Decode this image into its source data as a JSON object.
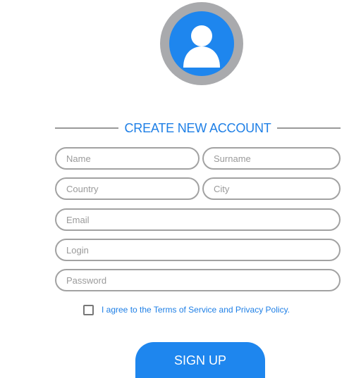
{
  "header": {
    "avatar_icon": "user-silhouette-icon",
    "title": "CREATE NEW ACCOUNT"
  },
  "form": {
    "name_placeholder": "Name",
    "surname_placeholder": "Surname",
    "country_placeholder": "Country",
    "city_placeholder": "City",
    "email_placeholder": "Email",
    "login_placeholder": "Login",
    "password_placeholder": "Password",
    "terms_label": "I agree to the Terms of Service and Privacy Policy.",
    "terms_checked": false,
    "submit_label": "SIGN UP"
  },
  "colors": {
    "accent": "#1e86ee",
    "ring": "#a9aaad",
    "field_border": "#a2a2a2"
  }
}
